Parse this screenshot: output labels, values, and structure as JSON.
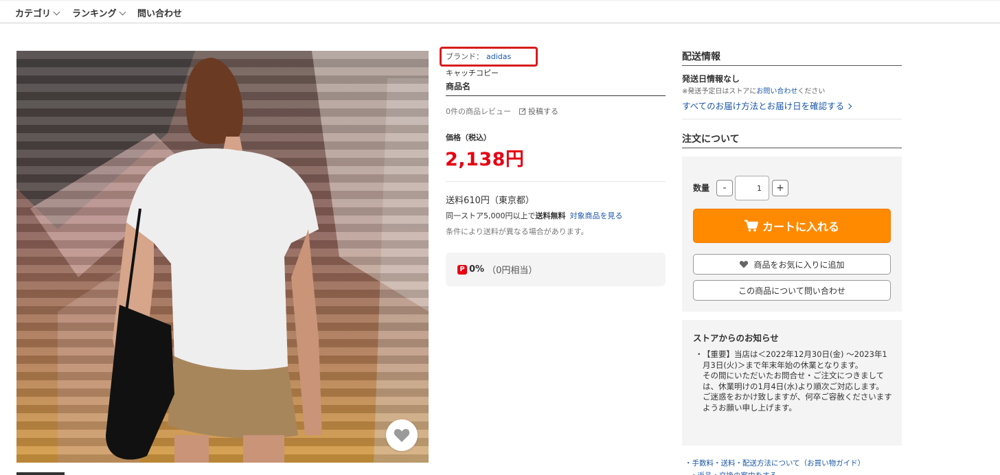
{
  "nav": {
    "items": [
      {
        "label": "カテゴリ",
        "has_dropdown": true
      },
      {
        "label": "ランキング",
        "has_dropdown": true
      },
      {
        "label": "問い合わせ",
        "has_dropdown": false
      }
    ]
  },
  "product": {
    "image_alt": "Woman in white t-shirt and khaki shorts with black drawstring bag in front of a painted shutter",
    "brand_label": "ブランド：",
    "brand_name": "adidas",
    "catch_copy": "キャッチコピー",
    "name": "商品名",
    "review_count": "0件の商品レビュー",
    "post_review": "投稿する",
    "price_label": "価格（税込）",
    "price": "2,138円",
    "shipping_fee": "送料610円（東京都）",
    "free_shipping_prefix": "同一ストア5,000円以上で",
    "free_shipping_bold": "送料無料",
    "free_shipping_link": "対象商品を見る",
    "shipping_condition": "条件により送料が異なる場合があります。",
    "points_percent": "0%",
    "points_equiv": "（0円相当）"
  },
  "delivery": {
    "title": "配送情報",
    "ship_date": "発送日情報なし",
    "note_prefix": "※発送予定日はストアに",
    "note_link": "お問い合わせ",
    "note_suffix": "ください",
    "all_methods_link": "すべてのお届け方法とお届け日を確認する"
  },
  "order": {
    "title": "注文について",
    "qty_label": "数量",
    "qty_minus": "-",
    "qty_value": "1",
    "qty_plus": "+",
    "cart_button": "カートに入れる",
    "favorite_button": "商品をお気に入りに追加",
    "inquiry_button": "この商品について問い合わせ"
  },
  "notice": {
    "title": "ストアからのお知らせ",
    "bullet": "・",
    "line1": "【重要】当店は＜2022年12月30日(金) ～2023年1月3日(火)＞まで年末年始の休業となります。",
    "line2": "その間にいただいたお問合せ・ご注文につきましては、休業明けの1月4日(水)より順次ご対応します。",
    "line3": "ご迷惑をおかけ致しますが、何卒ご容赦くださいますようお願い申し上げます。"
  },
  "footer_links": {
    "guide": "・手数料・送料・配送方法について（お買い物ガイド）",
    "next": "・返品・交換の案内をする"
  },
  "colors": {
    "price_red": "#e60012",
    "link_blue": "#1a56a8",
    "cart_orange": "#ff8a00",
    "highlight_red": "#d81b1b"
  }
}
